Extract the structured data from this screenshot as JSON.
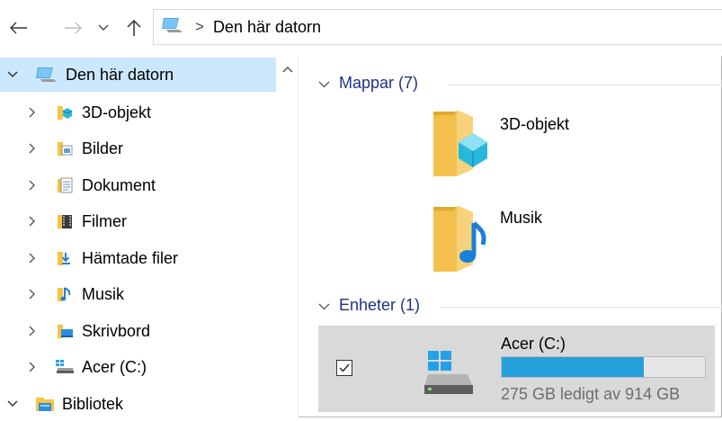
{
  "address": {
    "breadcrumb": "Den här datorn",
    "separator": ">"
  },
  "nav_pane": {
    "items": [
      {
        "label": "Den här datorn",
        "icon": "pc-icon",
        "expanded": true,
        "selected": true
      },
      {
        "label": "3D-objekt",
        "icon": "3d-objects-folder-icon"
      },
      {
        "label": "Bilder",
        "icon": "pictures-folder-icon"
      },
      {
        "label": "Dokument",
        "icon": "documents-folder-icon"
      },
      {
        "label": "Filmer",
        "icon": "videos-folder-icon"
      },
      {
        "label": "Hämtade filer",
        "icon": "downloads-folder-icon"
      },
      {
        "label": "Musik",
        "icon": "music-folder-icon"
      },
      {
        "label": "Skrivbord",
        "icon": "desktop-folder-icon"
      },
      {
        "label": "Acer (C:)",
        "icon": "drive-icon"
      },
      {
        "label": "Bibliotek",
        "icon": "library-icon",
        "expanded": true
      }
    ]
  },
  "content": {
    "folders_group": {
      "title": "Mappar (7)",
      "items": [
        {
          "label": "3D-objekt",
          "icon": "3d-objects-folder-icon"
        },
        {
          "label": "Musik",
          "icon": "music-folder-icon"
        }
      ]
    },
    "drives_group": {
      "title": "Enheter (1)",
      "items": [
        {
          "label": "Acer (C:)",
          "free_text": "275 GB ledigt av 914 GB",
          "used_fraction": 0.7,
          "checked": true
        }
      ]
    }
  },
  "colors": {
    "selection": "#cce8ff",
    "group_header": "#1e3287",
    "drive_bar": "#26a0da"
  }
}
